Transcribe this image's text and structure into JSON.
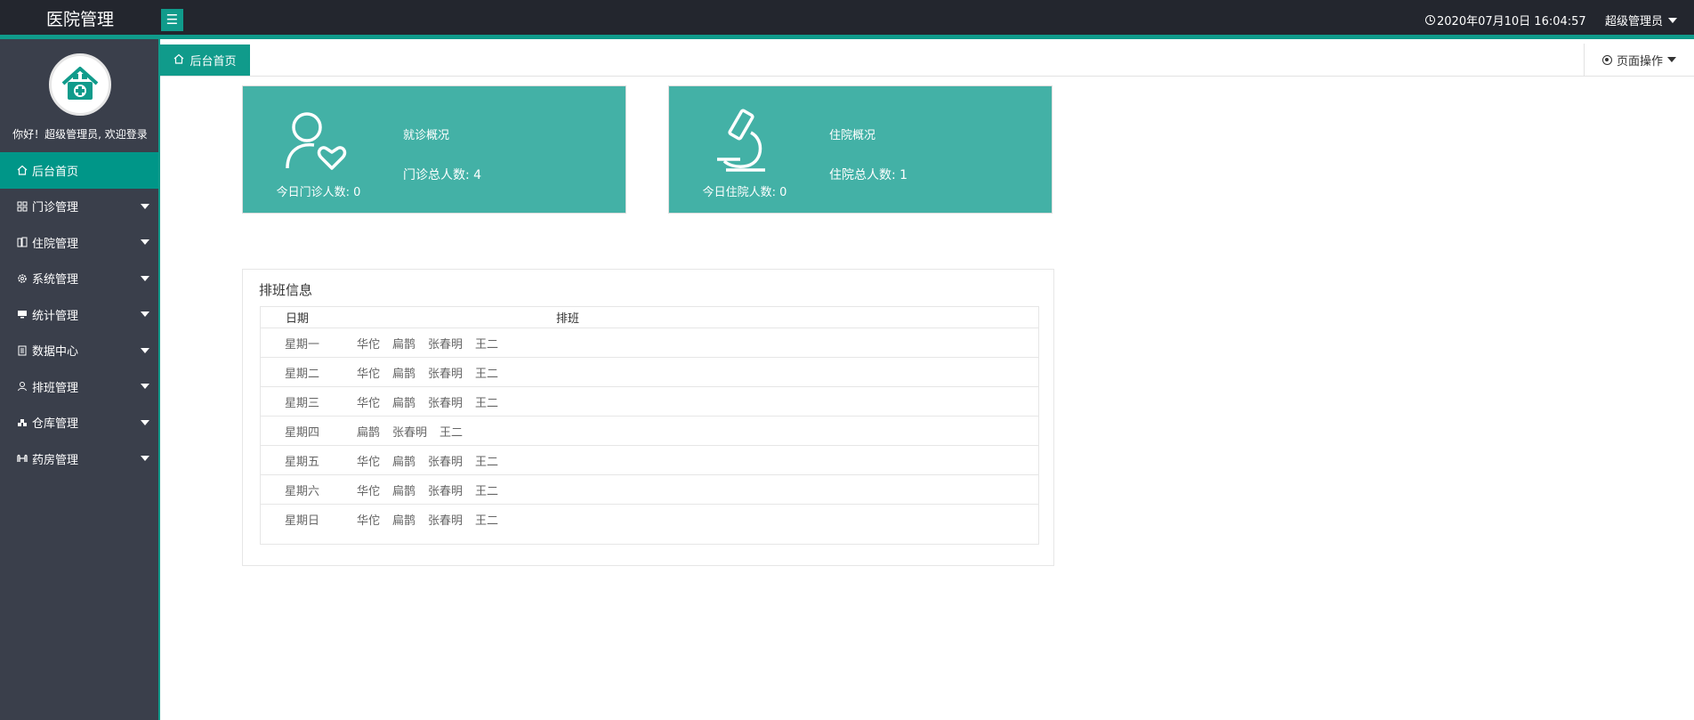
{
  "app": {
    "title": "医院管理"
  },
  "header": {
    "datetime": "2020年07月10日 16:04:57",
    "user": "超级管理员",
    "accent": "#109b8b"
  },
  "sidebar": {
    "welcome": "你好！超级管理员, 欢迎登录",
    "items": [
      {
        "label": "后台首页",
        "icon": "home-icon"
      },
      {
        "label": "门诊管理",
        "icon": "apps-icon"
      },
      {
        "label": "住院管理",
        "icon": "building-icon"
      },
      {
        "label": "系统管理",
        "icon": "gear-icon"
      },
      {
        "label": "统计管理",
        "icon": "monitor-icon"
      },
      {
        "label": "数据中心",
        "icon": "document-icon"
      },
      {
        "label": "排班管理",
        "icon": "user-icon"
      },
      {
        "label": "仓库管理",
        "icon": "warehouse-icon"
      },
      {
        "label": "药房管理",
        "icon": "pharmacy-icon"
      }
    ]
  },
  "tabs": {
    "home": "后台首页",
    "page_ops": "页面操作"
  },
  "cards": [
    {
      "today": "今日门诊人数: 0",
      "title": "就诊概况",
      "total": "门诊总人数: 4",
      "icon": "person-heart-icon"
    },
    {
      "today": "今日住院人数: 0",
      "title": "住院概况",
      "total": "住院总人数: 1",
      "icon": "microscope-icon"
    }
  ],
  "schedule": {
    "title": "排班信息",
    "headers": [
      "日期",
      "排班"
    ],
    "rows": [
      {
        "day": "星期一",
        "doctors": [
          "华佗",
          "扁鹊",
          "张春明",
          "王二"
        ]
      },
      {
        "day": "星期二",
        "doctors": [
          "华佗",
          "扁鹊",
          "张春明",
          "王二"
        ]
      },
      {
        "day": "星期三",
        "doctors": [
          "华佗",
          "扁鹊",
          "张春明",
          "王二"
        ]
      },
      {
        "day": "星期四",
        "doctors": [
          "扁鹊",
          "张春明",
          "王二"
        ]
      },
      {
        "day": "星期五",
        "doctors": [
          "华佗",
          "扁鹊",
          "张春明",
          "王二"
        ]
      },
      {
        "day": "星期六",
        "doctors": [
          "华佗",
          "扁鹊",
          "张春明",
          "王二"
        ]
      },
      {
        "day": "星期日",
        "doctors": [
          "华佗",
          "扁鹊",
          "张春明",
          "王二"
        ]
      }
    ]
  }
}
